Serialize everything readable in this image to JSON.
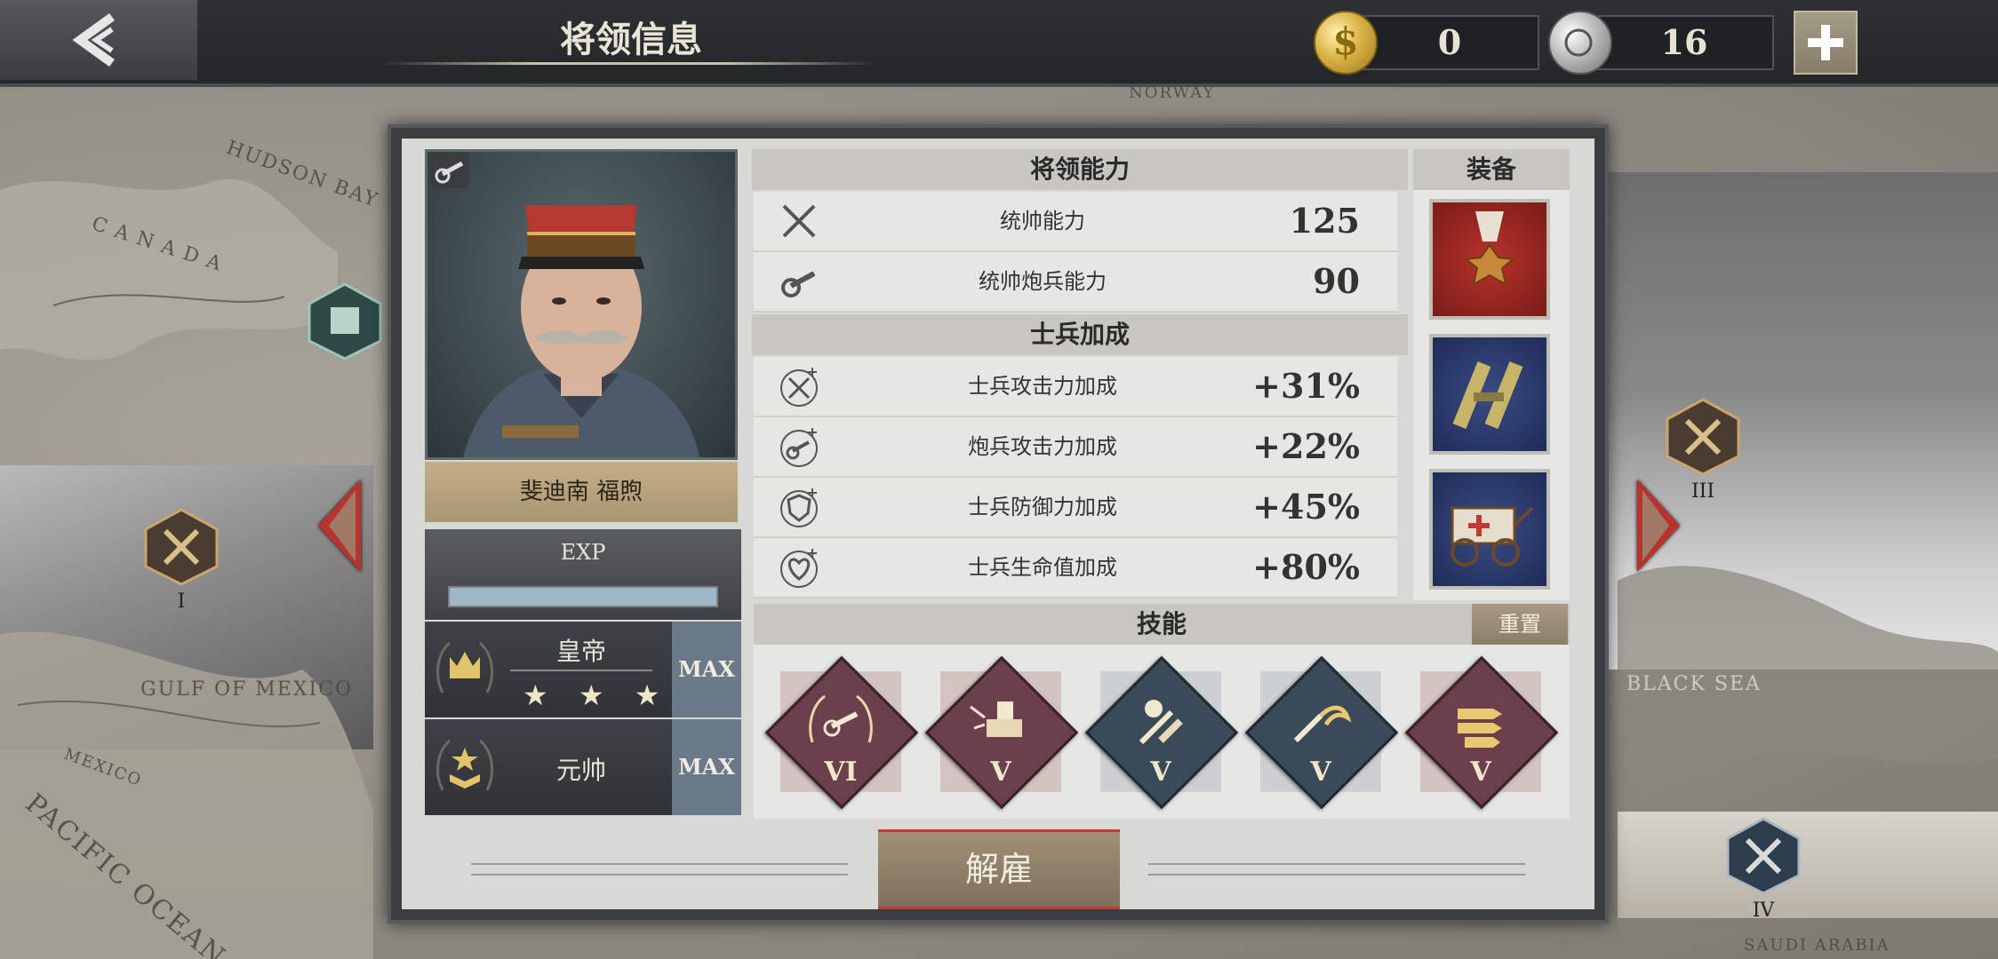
{
  "topbar": {
    "title": "将领信息",
    "gold_amount": "0",
    "silver_amount": "16",
    "gold_coin_symbol": "$",
    "silver_coin_icon": "medal-coin-icon"
  },
  "map": {
    "labels": [
      "HUDSON BAY",
      "CANADA",
      "GULF OF MEXICO",
      "MEXICO",
      "PACIFIC OCEAN",
      "NORWAY",
      "BLACK SEA",
      "SAUDI ARABIA"
    ],
    "nodes": [
      "I",
      "III",
      "IV"
    ]
  },
  "general": {
    "name": "斐迪南 福煦",
    "exp_label": "EXP",
    "exp_fill_fraction": 1.0,
    "title_rank": "皇帝",
    "title_stars": "★ ★ ★",
    "title_max": "MAX",
    "military_rank": "元帅",
    "rank_max": "MAX"
  },
  "abilities": {
    "header": "将领能力",
    "rows": [
      {
        "label": "统帅能力",
        "value": "125",
        "icon": "crossed-swords-icon"
      },
      {
        "label": "统帅炮兵能力",
        "value": "90",
        "icon": "cannon-icon"
      }
    ]
  },
  "bonuses": {
    "header": "士兵加成",
    "rows": [
      {
        "label": "士兵攻击力加成",
        "value": "+31%",
        "icon": "swords-plus-icon"
      },
      {
        "label": "炮兵攻击力加成",
        "value": "+22%",
        "icon": "cannon-plus-icon"
      },
      {
        "label": "士兵防御力加成",
        "value": "+45%",
        "icon": "shield-plus-icon"
      },
      {
        "label": "士兵生命值加成",
        "value": "+80%",
        "icon": "heart-plus-icon"
      }
    ]
  },
  "equipment": {
    "header": "装备",
    "items": [
      "iron-cross-medal-icon",
      "binoculars-icon",
      "ambulance-cart-icon"
    ]
  },
  "skills": {
    "header": "技能",
    "reset_label": "重置",
    "items": [
      {
        "level": "VI",
        "icon": "laurel-cannon-icon",
        "color": "#6b3f4c"
      },
      {
        "level": "V",
        "icon": "fortress-blast-icon",
        "color": "#6b3f4c"
      },
      {
        "level": "V",
        "icon": "bandage-knife-icon",
        "color": "#3b4a58"
      },
      {
        "level": "V",
        "icon": "knife-sickle-icon",
        "color": "#3b4a58"
      },
      {
        "level": "V",
        "icon": "shells-icon",
        "color": "#6b3f4c"
      }
    ]
  },
  "actions": {
    "dismiss_label": "解雇"
  },
  "colors": {
    "accent_red": "#c23a34",
    "panel_dark": "#3a3d40",
    "plate_gold": "#c3b08a"
  }
}
